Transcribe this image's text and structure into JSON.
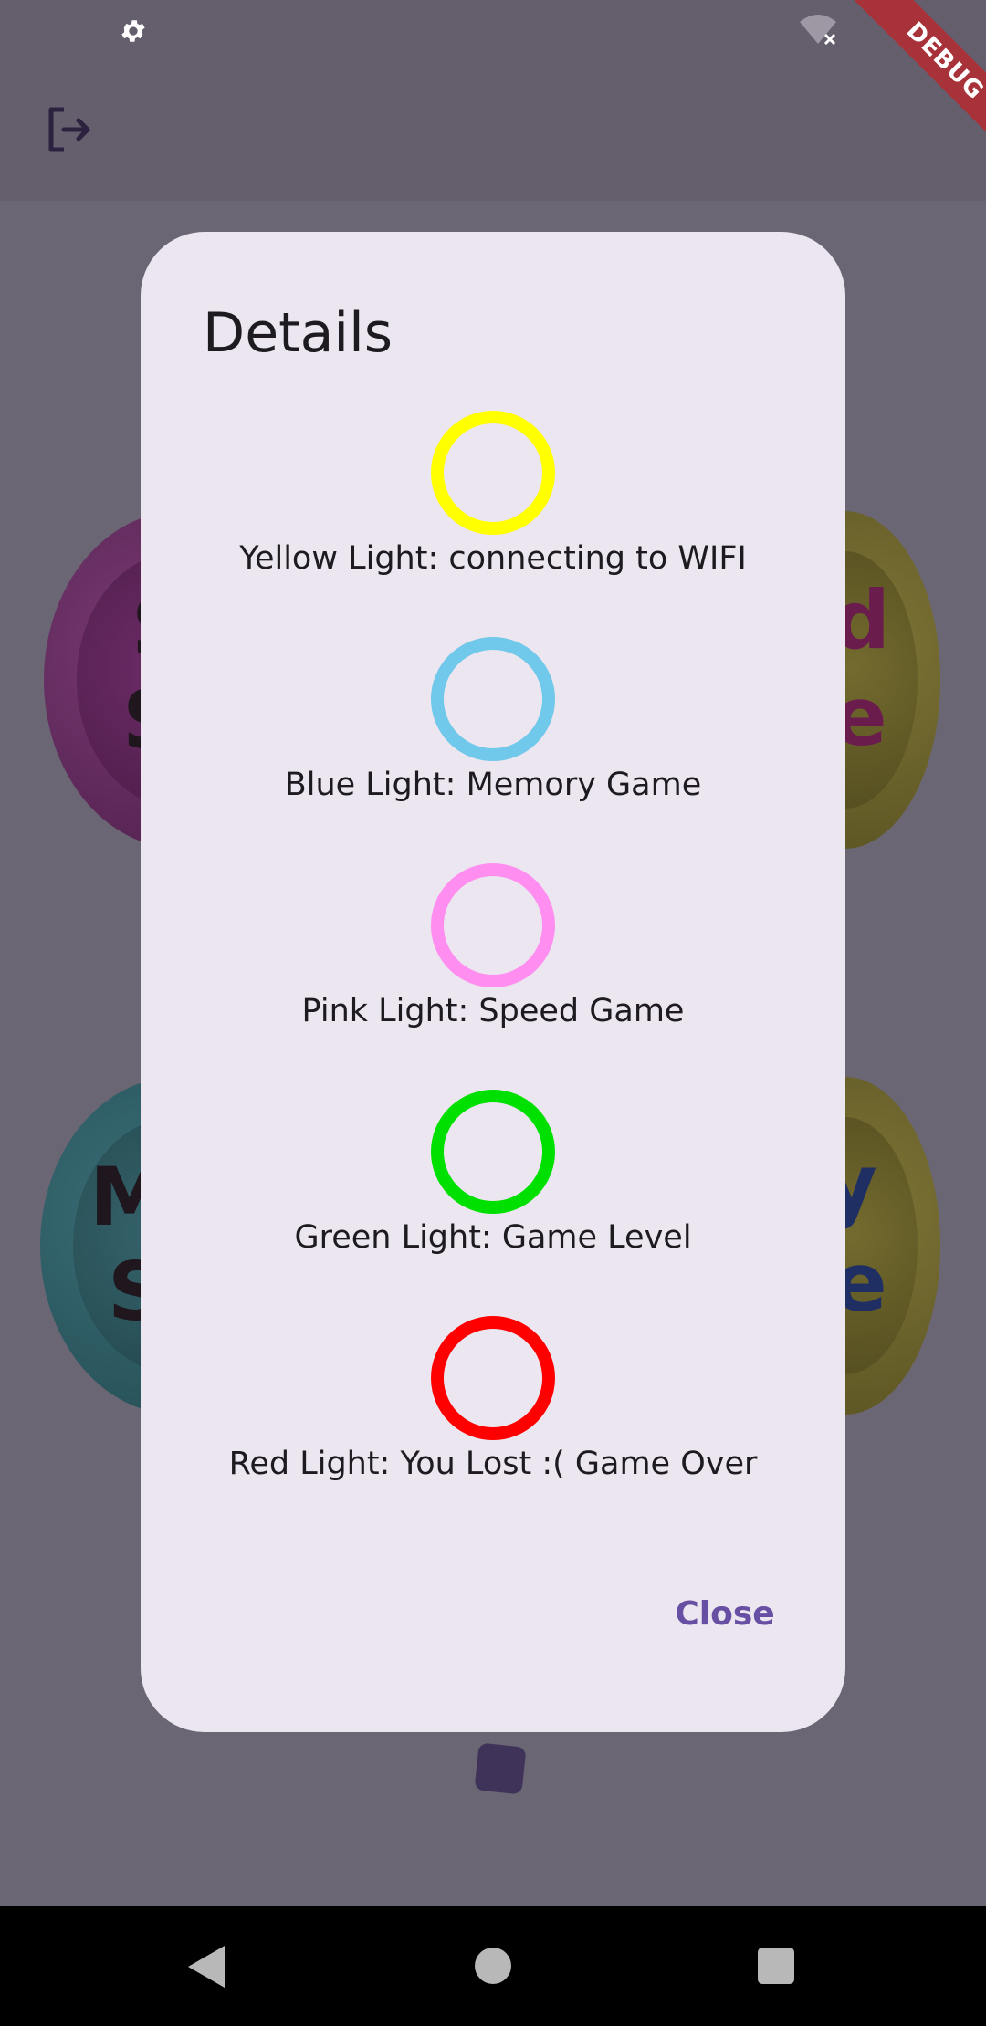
{
  "debug_banner": {
    "label": "DEBUG"
  },
  "background_buttons": {
    "purple_letters": [
      "S",
      "S"
    ],
    "olive_top_letters": [
      "d",
      "e"
    ],
    "teal_letters": [
      "M",
      "S"
    ],
    "olive_bottom_letters": [
      "ry",
      "e"
    ]
  },
  "dialog": {
    "title": "Details",
    "items": [
      {
        "color": "#ffff00",
        "label": "Yellow Light: connecting to WIFI"
      },
      {
        "color": "#70c8eb",
        "label": "Blue Light: Memory Game"
      },
      {
        "color": "#ff8ef0",
        "label": "Pink Light: Speed Game"
      },
      {
        "color": "#00e000",
        "label": "Green Light: Game Level"
      },
      {
        "color": "#ff0000",
        "label": "Red Light: You Lost :( Game Over"
      }
    ],
    "close_label": "Close"
  },
  "icons": {
    "status_settings": "gear-icon",
    "status_wifi": "wifi-off-icon",
    "app_bar_logout": "logout-icon",
    "nav_back": "back-icon",
    "nav_home": "home-icon",
    "nav_recents": "recents-icon"
  }
}
